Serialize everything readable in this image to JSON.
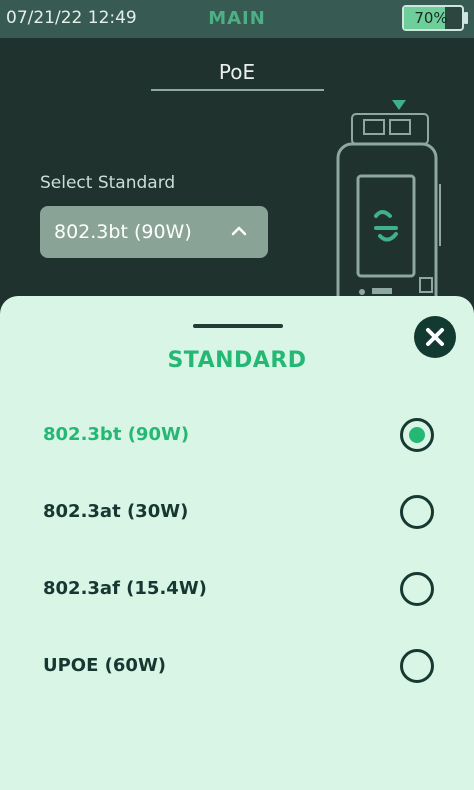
{
  "status_bar": {
    "time": "07/21/22 12:49",
    "title": "MAIN",
    "battery_percent": 70,
    "battery_label": "70%"
  },
  "page": {
    "title": "PoE",
    "select_label": "Select Standard",
    "selected_value": "802.3bt (90W)"
  },
  "sheet": {
    "title": "STANDARD",
    "options": [
      {
        "label": "802.3bt (90W)",
        "selected": true
      },
      {
        "label": "802.3at (30W)",
        "selected": false
      },
      {
        "label": "802.3af (15.4W)",
        "selected": false
      },
      {
        "label": "UPOE (60W)",
        "selected": false
      }
    ]
  },
  "colors": {
    "background": "#1f322d",
    "status_bar": "#375a52",
    "accent": "#25b874",
    "sheet": "#d9f5e6",
    "dark_text": "#173832"
  },
  "icons": {
    "select_chevron": "chevron-up-icon",
    "close": "close-icon",
    "device": "tester-device-icon"
  }
}
